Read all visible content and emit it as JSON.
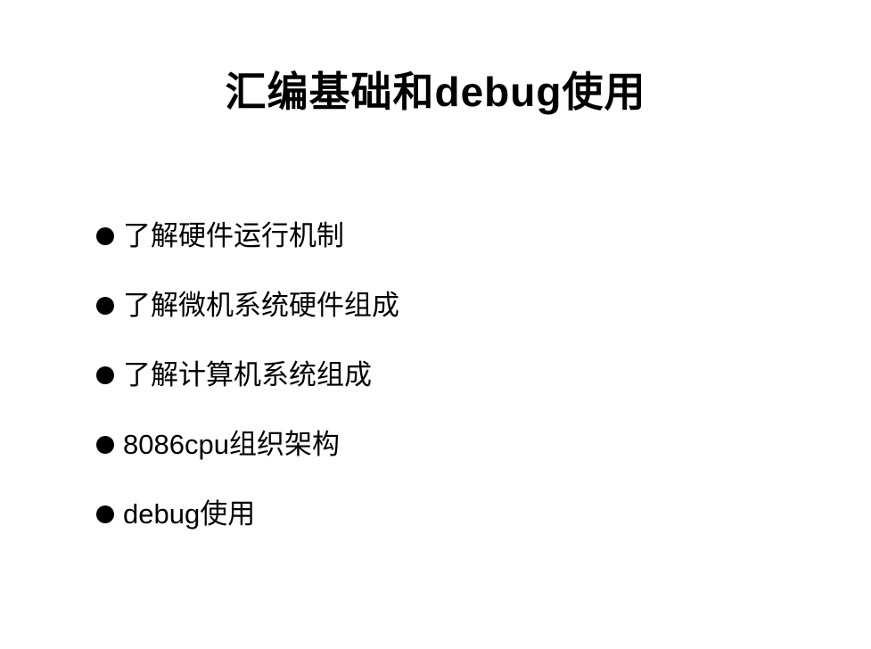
{
  "slide": {
    "title": "汇编基础和debug使用",
    "bullets": [
      "了解硬件运行机制",
      "了解微机系统硬件组成",
      "了解计算机系统组成",
      "8086cpu组织架构",
      "debug使用"
    ]
  },
  "colors": {
    "background": "#ffffff",
    "text": "#000000"
  }
}
